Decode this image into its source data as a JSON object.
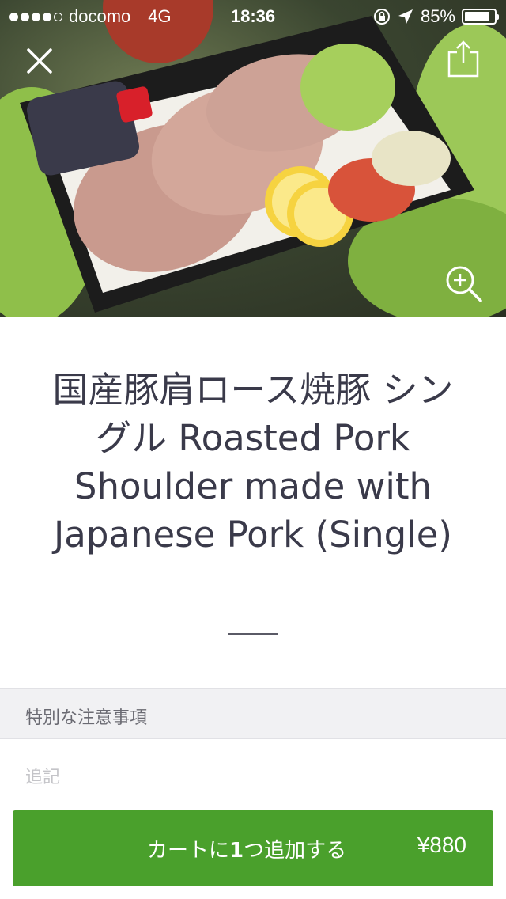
{
  "status_bar": {
    "carrier": "docomo",
    "network": "4G",
    "time": "18:36",
    "battery_percent": "85%",
    "battery_level": 0.85,
    "signal_bars_filled": 4,
    "signal_bars_total": 5
  },
  "hero": {
    "close_icon": "close-icon",
    "share_icon": "share-icon",
    "zoom_icon": "zoom-in-icon"
  },
  "item": {
    "title": "国産豚肩ロース焼豚 シングル  Roasted Pork Shoulder made with Japanese Pork (Single)"
  },
  "special_instructions": {
    "header": "特別な注意事項",
    "placeholder": "追記"
  },
  "cart": {
    "label_prefix": "カートに",
    "quantity": "1",
    "label_suffix": "つ追加する",
    "price": "¥880"
  },
  "colors": {
    "accent_green": "#4aa02c",
    "title_text": "#3a3a4a",
    "section_bg": "#f1f1f3"
  }
}
